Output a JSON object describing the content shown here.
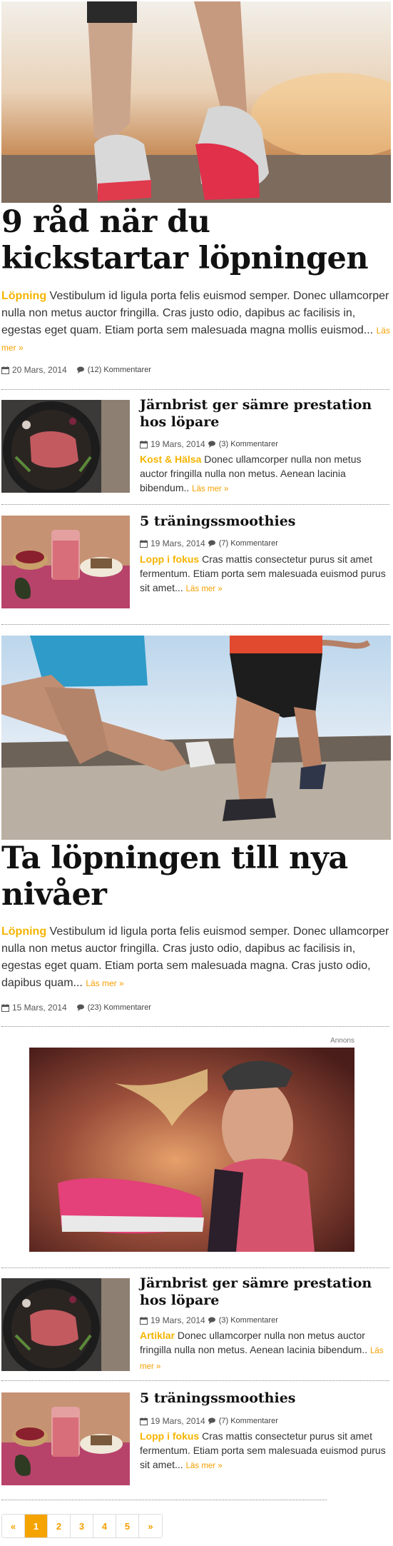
{
  "featured": [
    {
      "title": "9 råd när du kickstartar löpningen",
      "category": "Löpning",
      "excerpt": "Vestibulum id ligula porta felis euismod semper. Donec ullamcorper nulla non metus auctor fringilla. Cras justo odio, dapibus ac facilisis in, egestas eget quam. Etiam porta sem malesuada magna mollis euismod...",
      "read_more": "Läs mer »",
      "date": "20 Mars, 2014",
      "comments": "(12) Kommentarer"
    },
    {
      "title": "Ta löpningen till nya nivåer",
      "category": "Löpning",
      "excerpt": "Vestibulum id ligula porta felis euismod semper. Donec ullamcorper nulla non metus auctor fringilla. Cras justo odio, dapibus ac facilisis in, egestas eget quam. Etiam porta sem malesuada magna. Cras justo odio, dapibus quam...",
      "read_more": "Läs mer »",
      "date": "15 Mars, 2014",
      "comments": "(23) Kommentarer"
    }
  ],
  "small_posts": [
    {
      "title": "Järnbrist ger sämre prestation hos löpare",
      "date": "19 Mars, 2014",
      "comments": "(3) Kommentarer",
      "category": "Kost & Hälsa",
      "excerpt": "Donec ullamcorper nulla non metus auctor fringilla nulla non metus. Aenean lacinia bibendum..",
      "read_more": "Läs mer »"
    },
    {
      "title": "5 träningssmoothies",
      "date": "19 Mars, 2014",
      "comments": "(7) Kommentarer",
      "category": "Lopp i fokus",
      "excerpt": "Cras mattis consectetur purus sit amet fermentum. Etiam porta sem malesuada euismod purus sit amet...",
      "read_more": "Läs mer »"
    },
    {
      "title": "Järnbrist ger sämre prestation hos löpare",
      "date": "19 Mars, 2014",
      "comments": "(3) Kommentarer",
      "category": "Artiklar",
      "excerpt": "Donec ullamcorper nulla non metus auctor fringilla nulla non metus. Aenean lacinia bibendum..",
      "read_more": "Läs mer »"
    },
    {
      "title": "5 träningssmoothies",
      "date": "19 Mars, 2014",
      "comments": "(7) Kommentarer",
      "category": "Lopp i fokus",
      "excerpt": "Cras mattis consectetur purus sit amet fermentum. Etiam porta sem malesuada euismod purus sit amet...",
      "read_more": "Läs mer »"
    }
  ],
  "ad": {
    "label": "Annons"
  },
  "pagination": {
    "prev": "«",
    "pages": [
      "1",
      "2",
      "3",
      "4",
      "5"
    ],
    "next": "»",
    "current": "1"
  },
  "colors": {
    "accent": "#f5a300",
    "category": "#f5b400",
    "title": "#111111"
  },
  "icons": {
    "date": "calendar-icon",
    "comments": "comments-icon"
  }
}
